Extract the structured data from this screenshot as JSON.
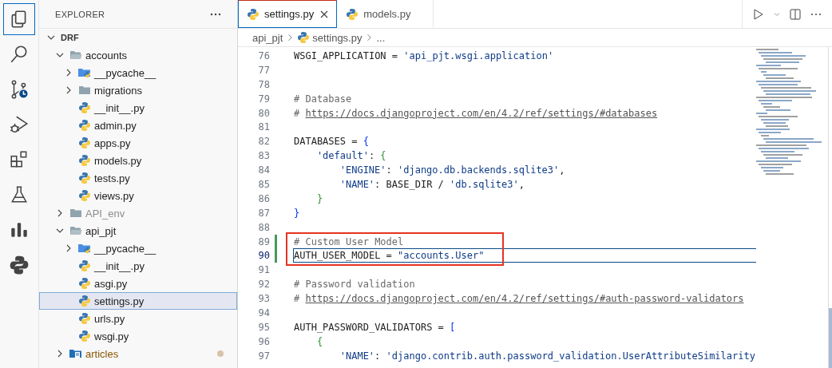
{
  "activity_bar": [
    {
      "kind": "files",
      "selected": true
    },
    {
      "kind": "search",
      "selected": false
    },
    {
      "kind": "source-control",
      "selected": false
    },
    {
      "kind": "run",
      "selected": false
    },
    {
      "kind": "extensions",
      "selected": false
    },
    {
      "kind": "testing",
      "selected": false
    },
    {
      "kind": "chart",
      "selected": false
    },
    {
      "kind": "python",
      "selected": false
    }
  ],
  "explorer": {
    "title": "EXPLORER",
    "tree": [
      {
        "label": "DRF",
        "kind": "root",
        "expanded": true,
        "selected": false,
        "children": [
          {
            "label": "accounts",
            "kind": "folder",
            "expanded": true,
            "selected": false,
            "children": [
              {
                "label": "__pycache__",
                "kind": "pyfolder",
                "expanded": false,
                "selected": false
              },
              {
                "label": "migrations",
                "kind": "folder",
                "expanded": false,
                "selected": false
              },
              {
                "label": "__init__.py",
                "kind": "py",
                "selected": false
              },
              {
                "label": "admin.py",
                "kind": "py",
                "selected": false
              },
              {
                "label": "apps.py",
                "kind": "py",
                "selected": false
              },
              {
                "label": "models.py",
                "kind": "py",
                "selected": false
              },
              {
                "label": "tests.py",
                "kind": "py",
                "selected": false
              },
              {
                "label": "views.py",
                "kind": "py",
                "selected": false
              }
            ]
          },
          {
            "label": "API_env",
            "kind": "folder",
            "expanded": false,
            "ignored": true,
            "selected": false
          },
          {
            "label": "api_pjt",
            "kind": "folder",
            "expanded": true,
            "selected": false,
            "children": [
              {
                "label": "__pycache__",
                "kind": "pyfolder",
                "expanded": false,
                "selected": false
              },
              {
                "label": "__init__.py",
                "kind": "py",
                "selected": false
              },
              {
                "label": "asgi.py",
                "kind": "py",
                "selected": false
              },
              {
                "label": "settings.py",
                "kind": "py",
                "selected": true
              },
              {
                "label": "urls.py",
                "kind": "py",
                "selected": false
              },
              {
                "label": "wsgi.py",
                "kind": "py",
                "selected": false
              }
            ]
          },
          {
            "label": "articles",
            "kind": "package",
            "expanded": false,
            "modified": true,
            "selected": false
          }
        ]
      }
    ]
  },
  "tabs": [
    {
      "label": "settings.py",
      "selected": true
    },
    {
      "label": "models.py",
      "selected": false
    }
  ],
  "breadcrumb": [
    "api_pjt",
    "settings.py",
    "..."
  ],
  "code": [
    {
      "number": "76",
      "tokens": [
        {
          "t": "WSGI_APPLICATION = ",
          "kind": "plain"
        },
        {
          "t": "'api_pjt.wsgi.application'",
          "kind": "string"
        }
      ]
    },
    {
      "number": "77"
    },
    {
      "number": "78"
    },
    {
      "number": "79",
      "tokens": [
        {
          "t": "# Database",
          "kind": "comment"
        }
      ]
    },
    {
      "number": "80",
      "tokens": [
        {
          "t": "# ",
          "kind": "comment"
        },
        {
          "t": "https://docs.djangoproject.com/en/4.2/ref/settings/#databases",
          "kind": "link"
        }
      ]
    },
    {
      "number": "81"
    },
    {
      "number": "82",
      "tokens": [
        {
          "t": "DATABASES = ",
          "kind": "plain"
        },
        {
          "t": "{",
          "kind": "bracket1"
        }
      ],
      "children": [
        {
          "number": "83",
          "tokens": [
            {
              "t": "'default'",
              "kind": "string"
            },
            {
              "t": ": ",
              "kind": "plain"
            },
            {
              "t": "{",
              "kind": "bracket2"
            }
          ],
          "children": [
            {
              "number": "84",
              "tokens": [
                {
                  "t": "'ENGINE'",
                  "kind": "string"
                },
                {
                  "t": ": ",
                  "kind": "plain"
                },
                {
                  "t": "'django.db.backends.sqlite3'",
                  "kind": "string"
                },
                {
                  "t": ",",
                  "kind": "plain"
                }
              ]
            },
            {
              "number": "85",
              "tokens": [
                {
                  "t": "'NAME'",
                  "kind": "string"
                },
                {
                  "t": ": BASE_DIR / ",
                  "kind": "plain"
                },
                {
                  "t": "'db.sqlite3'",
                  "kind": "string"
                },
                {
                  "t": ",",
                  "kind": "plain"
                }
              ]
            }
          ]
        },
        {
          "number": "86",
          "tokens": [
            {
              "t": "}",
              "kind": "bracket2"
            }
          ]
        }
      ]
    },
    {
      "number": "87",
      "tokens": [
        {
          "t": "}",
          "kind": "bracket1"
        }
      ]
    },
    {
      "number": "88"
    },
    {
      "number": "89",
      "modified": true,
      "boxed": true,
      "current": false,
      "tokens": [
        {
          "t": "# Custom User Model",
          "kind": "comment"
        }
      ]
    },
    {
      "number": "90",
      "modified": true,
      "boxed": true,
      "current": true,
      "tokens": [
        {
          "t": "AUTH_USER_MODEL = ",
          "kind": "plain"
        },
        {
          "t": "\"accounts.User\"",
          "kind": "string"
        }
      ]
    },
    {
      "number": "91"
    },
    {
      "number": "92",
      "tokens": [
        {
          "t": "# Password validation",
          "kind": "comment"
        }
      ]
    },
    {
      "number": "93",
      "tokens": [
        {
          "t": "# ",
          "kind": "comment"
        },
        {
          "t": "https://docs.djangoproject.com/en/4.2/ref/settings/#auth-password-validators",
          "kind": "link"
        }
      ]
    },
    {
      "number": "94"
    },
    {
      "number": "95",
      "tokens": [
        {
          "t": "AUTH_PASSWORD_VALIDATORS = ",
          "kind": "plain"
        },
        {
          "t": "[",
          "kind": "bracket1"
        }
      ],
      "children": [
        {
          "number": "96",
          "tokens": [
            {
              "t": "{",
              "kind": "bracket2"
            }
          ],
          "children": [
            {
              "number": "97",
              "tokens": [
                {
                  "t": "'NAME'",
                  "kind": "string"
                },
                {
                  "t": ": ",
                  "kind": "plain"
                },
                {
                  "t": "'django.contrib.auth.password_validation.UserAttributeSimilarity",
                  "kind": "string"
                }
              ]
            }
          ]
        }
      ]
    }
  ]
}
